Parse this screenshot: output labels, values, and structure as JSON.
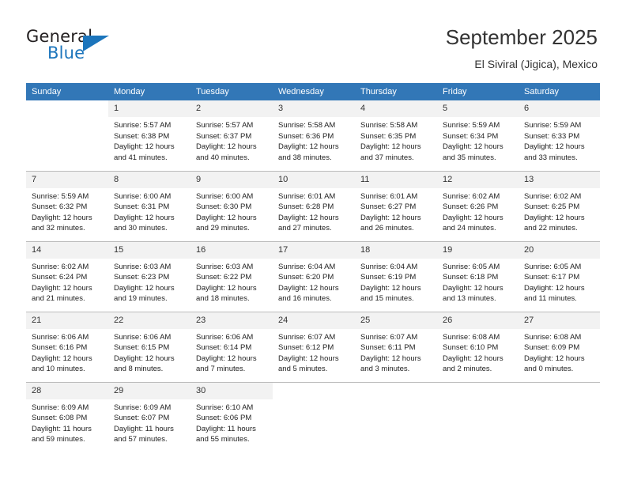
{
  "brand": {
    "word1": "General",
    "word2": "Blue",
    "logo_color": "#1c75bc"
  },
  "header": {
    "title": "September 2025",
    "subtitle": "El Siviral (Jigica), Mexico",
    "header_bg": "#3277b7",
    "daynum_bg": "#f2f2f2"
  },
  "calendar": {
    "weekday_headers": [
      "Sunday",
      "Monday",
      "Tuesday",
      "Wednesday",
      "Thursday",
      "Friday",
      "Saturday"
    ],
    "weeks": [
      [
        {
          "day": "",
          "lines": []
        },
        {
          "day": "1",
          "lines": [
            "Sunrise: 5:57 AM",
            "Sunset: 6:38 PM",
            "Daylight: 12 hours",
            "and 41 minutes."
          ]
        },
        {
          "day": "2",
          "lines": [
            "Sunrise: 5:57 AM",
            "Sunset: 6:37 PM",
            "Daylight: 12 hours",
            "and 40 minutes."
          ]
        },
        {
          "day": "3",
          "lines": [
            "Sunrise: 5:58 AM",
            "Sunset: 6:36 PM",
            "Daylight: 12 hours",
            "and 38 minutes."
          ]
        },
        {
          "day": "4",
          "lines": [
            "Sunrise: 5:58 AM",
            "Sunset: 6:35 PM",
            "Daylight: 12 hours",
            "and 37 minutes."
          ]
        },
        {
          "day": "5",
          "lines": [
            "Sunrise: 5:59 AM",
            "Sunset: 6:34 PM",
            "Daylight: 12 hours",
            "and 35 minutes."
          ]
        },
        {
          "day": "6",
          "lines": [
            "Sunrise: 5:59 AM",
            "Sunset: 6:33 PM",
            "Daylight: 12 hours",
            "and 33 minutes."
          ]
        }
      ],
      [
        {
          "day": "7",
          "lines": [
            "Sunrise: 5:59 AM",
            "Sunset: 6:32 PM",
            "Daylight: 12 hours",
            "and 32 minutes."
          ]
        },
        {
          "day": "8",
          "lines": [
            "Sunrise: 6:00 AM",
            "Sunset: 6:31 PM",
            "Daylight: 12 hours",
            "and 30 minutes."
          ]
        },
        {
          "day": "9",
          "lines": [
            "Sunrise: 6:00 AM",
            "Sunset: 6:30 PM",
            "Daylight: 12 hours",
            "and 29 minutes."
          ]
        },
        {
          "day": "10",
          "lines": [
            "Sunrise: 6:01 AM",
            "Sunset: 6:28 PM",
            "Daylight: 12 hours",
            "and 27 minutes."
          ]
        },
        {
          "day": "11",
          "lines": [
            "Sunrise: 6:01 AM",
            "Sunset: 6:27 PM",
            "Daylight: 12 hours",
            "and 26 minutes."
          ]
        },
        {
          "day": "12",
          "lines": [
            "Sunrise: 6:02 AM",
            "Sunset: 6:26 PM",
            "Daylight: 12 hours",
            "and 24 minutes."
          ]
        },
        {
          "day": "13",
          "lines": [
            "Sunrise: 6:02 AM",
            "Sunset: 6:25 PM",
            "Daylight: 12 hours",
            "and 22 minutes."
          ]
        }
      ],
      [
        {
          "day": "14",
          "lines": [
            "Sunrise: 6:02 AM",
            "Sunset: 6:24 PM",
            "Daylight: 12 hours",
            "and 21 minutes."
          ]
        },
        {
          "day": "15",
          "lines": [
            "Sunrise: 6:03 AM",
            "Sunset: 6:23 PM",
            "Daylight: 12 hours",
            "and 19 minutes."
          ]
        },
        {
          "day": "16",
          "lines": [
            "Sunrise: 6:03 AM",
            "Sunset: 6:22 PM",
            "Daylight: 12 hours",
            "and 18 minutes."
          ]
        },
        {
          "day": "17",
          "lines": [
            "Sunrise: 6:04 AM",
            "Sunset: 6:20 PM",
            "Daylight: 12 hours",
            "and 16 minutes."
          ]
        },
        {
          "day": "18",
          "lines": [
            "Sunrise: 6:04 AM",
            "Sunset: 6:19 PM",
            "Daylight: 12 hours",
            "and 15 minutes."
          ]
        },
        {
          "day": "19",
          "lines": [
            "Sunrise: 6:05 AM",
            "Sunset: 6:18 PM",
            "Daylight: 12 hours",
            "and 13 minutes."
          ]
        },
        {
          "day": "20",
          "lines": [
            "Sunrise: 6:05 AM",
            "Sunset: 6:17 PM",
            "Daylight: 12 hours",
            "and 11 minutes."
          ]
        }
      ],
      [
        {
          "day": "21",
          "lines": [
            "Sunrise: 6:06 AM",
            "Sunset: 6:16 PM",
            "Daylight: 12 hours",
            "and 10 minutes."
          ]
        },
        {
          "day": "22",
          "lines": [
            "Sunrise: 6:06 AM",
            "Sunset: 6:15 PM",
            "Daylight: 12 hours",
            "and 8 minutes."
          ]
        },
        {
          "day": "23",
          "lines": [
            "Sunrise: 6:06 AM",
            "Sunset: 6:14 PM",
            "Daylight: 12 hours",
            "and 7 minutes."
          ]
        },
        {
          "day": "24",
          "lines": [
            "Sunrise: 6:07 AM",
            "Sunset: 6:12 PM",
            "Daylight: 12 hours",
            "and 5 minutes."
          ]
        },
        {
          "day": "25",
          "lines": [
            "Sunrise: 6:07 AM",
            "Sunset: 6:11 PM",
            "Daylight: 12 hours",
            "and 3 minutes."
          ]
        },
        {
          "day": "26",
          "lines": [
            "Sunrise: 6:08 AM",
            "Sunset: 6:10 PM",
            "Daylight: 12 hours",
            "and 2 minutes."
          ]
        },
        {
          "day": "27",
          "lines": [
            "Sunrise: 6:08 AM",
            "Sunset: 6:09 PM",
            "Daylight: 12 hours",
            "and 0 minutes."
          ]
        }
      ],
      [
        {
          "day": "28",
          "lines": [
            "Sunrise: 6:09 AM",
            "Sunset: 6:08 PM",
            "Daylight: 11 hours",
            "and 59 minutes."
          ]
        },
        {
          "day": "29",
          "lines": [
            "Sunrise: 6:09 AM",
            "Sunset: 6:07 PM",
            "Daylight: 11 hours",
            "and 57 minutes."
          ]
        },
        {
          "day": "30",
          "lines": [
            "Sunrise: 6:10 AM",
            "Sunset: 6:06 PM",
            "Daylight: 11 hours",
            "and 55 minutes."
          ]
        },
        {
          "day": "",
          "lines": []
        },
        {
          "day": "",
          "lines": []
        },
        {
          "day": "",
          "lines": []
        },
        {
          "day": "",
          "lines": []
        }
      ]
    ]
  }
}
